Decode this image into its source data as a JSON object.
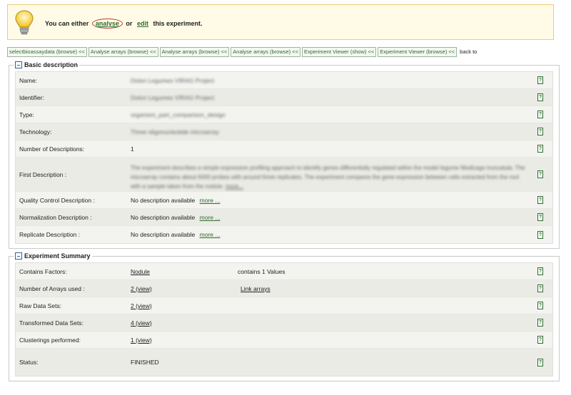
{
  "tip": {
    "prefix": "You can either",
    "analyse": "analyse",
    "or": "or",
    "edit": "edit",
    "suffix": "this experiment."
  },
  "breadcrumbs": [
    "selectbioassaydata (browse) <<",
    "Analyse arrays (browse) <<",
    "Analyse arrays (browse) <<",
    "Analyse arrays (browse) <<",
    "Experiment Viewer (show) <<",
    "Experiment Viewer (browse) <<"
  ],
  "back_to": "back to",
  "basic": {
    "legend": "Basic description",
    "help_glyph": "?",
    "rows": {
      "name": {
        "label": "Name:",
        "value": "Dolon Legumes VIRAG Project"
      },
      "identifier": {
        "label": "Identifier:",
        "value": "Dolon Legumes VIRAG Project"
      },
      "type": {
        "label": "Type:",
        "value": "organism_part_comparison_design"
      },
      "technology": {
        "label": "Technology:",
        "value": "Three oligonucleotide microarray"
      },
      "num_desc": {
        "label": "Number of Descriptions:",
        "value": "1"
      },
      "first_desc": {
        "label": "First Description :",
        "value": "The experiment describes a simple expression profiling approach to identify genes differentially regulated within the model legume Medicago truncatula. The microarray contains about 6000 probes with around three replicates. The experiment compares the gene expression between cells extracted from the root with a sample taken from the nodule.",
        "more": "more..."
      },
      "qc": {
        "label": "Quality Control Description :",
        "value": "No description available",
        "more": "more ..."
      },
      "norm": {
        "label": "Normalization Description :",
        "value": "No description available",
        "more": "more ..."
      },
      "repl": {
        "label": "Replicate Description :",
        "value": "No description available",
        "more": "more ..."
      }
    }
  },
  "summary": {
    "legend": "Experiment Summary",
    "help_glyph": "?",
    "rows": {
      "factors": {
        "label": "Contains Factors:",
        "value": "Nodule",
        "extra": "contains 1 Values"
      },
      "arrays": {
        "label": "Number of Arrays used :",
        "value": "2 (view)",
        "extra": "Link arrays"
      },
      "raw": {
        "label": "Raw Data Sets:",
        "value": "2 (view)"
      },
      "transformed": {
        "label": "Transformed Data Sets:",
        "value": "4 (view)"
      },
      "clusterings": {
        "label": "Clusterings performed:",
        "value": "1 (view)"
      },
      "status": {
        "label": "Status:",
        "value": "FINISHED"
      }
    }
  },
  "colors": {
    "link": "#2e6b2e",
    "status": "#e0b400",
    "tip_bg": "#fffbe6",
    "highlight": "#c0392b"
  },
  "icons": {
    "tip": "lightbulb-icon",
    "toggle": "collapse-icon",
    "help": "help-icon"
  }
}
